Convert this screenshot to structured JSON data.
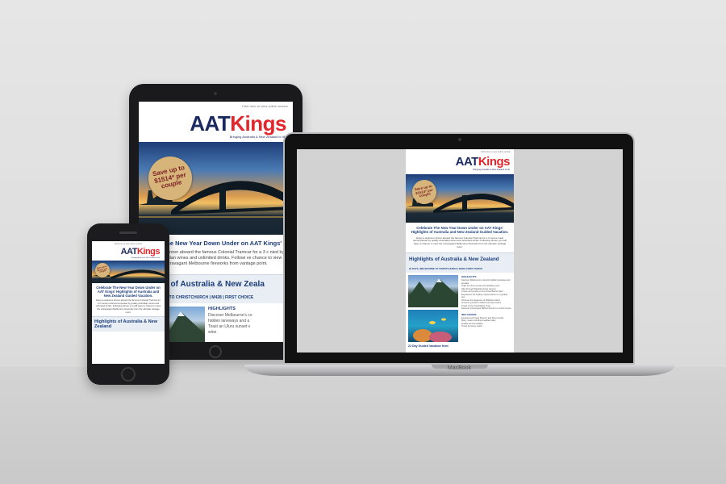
{
  "email": {
    "view_online": "Click here to view online version",
    "logo_aat": "AAT",
    "logo_kings": "Kings",
    "tagline": "Bringing Australia & New Zealand to life",
    "badge": "Save up to $1514* per couple",
    "headline": "Celebrate The New Year Down Under on AAT Kings' Highlights of Australia and New Zealand Guided Vacation.",
    "body": "Enjoy a welcome dinner aboard the famous Colonial Tramcar for a 3 course meal accompanied by quality Australian wines and unlimited drinks. Following dinner you will have to chance to view the extravagant Melbourne fireworks from the ultimate vantage point.",
    "section_title": "Highlights of Australia & New Zealand",
    "route": "22 DAYS | MELBOURNE TO CHRISTCHURCH | M428 | FIRST CHOICE",
    "highlights_title": "HIGHLIGHTS",
    "highlights": [
      "Discover Melbourne's colourful hidden laneways and arcades",
      "Toast an Uluru sunset with sparkling wine",
      "Hike through Watarrka Kings Canyon",
      "Cruise and snorkel on the Great Barrier Reef",
      "Experience the Sydney Opera House on a guided tour",
      "Discover the pleasures of Waiheke Island",
      "Immerse yourself in Maori food and culture",
      "Travel on the TranzAlpine Train",
      "Discover picturesque Milford Sound on a lunch cruise"
    ],
    "inclusions_title": "INCLUSIONS",
    "inclusions": [
      "Experienced Travel Director and Driver Guide",
      "Many meals including breakfast daily",
      "Quality accommodation",
      "Travel by luxury coach"
    ],
    "price_line": "22 Day Guided Vacation from"
  },
  "tablet": {
    "headline_visible": "lebrate The New Year Down Under on AAT Kings' ghlights of Australia and New Zealand Guided",
    "body_visible": "welcome dinner aboard the famous Colonial Tramcar for a 3 c nied by quality Australian wines and unlimited drinks. Followi ve chance to view the extravagant Melbourne fireworks from vantage point.",
    "section_visible": "hlights of Australia & New Zeala",
    "route_visible": "MELBOURNE TO CHRISTCHURCH | M428 | FIRST CHOICE",
    "hl_visible": [
      "Discover Melbourne's co",
      "hidden laneways and a",
      "Toast an Uluru sunset v",
      "wine"
    ]
  },
  "laptop": {
    "brand": "MacBook"
  },
  "colors": {
    "navy": "#1b2a5e",
    "red": "#e2262b",
    "link_blue": "#1b3c7a",
    "badge": "#d7b57a"
  }
}
